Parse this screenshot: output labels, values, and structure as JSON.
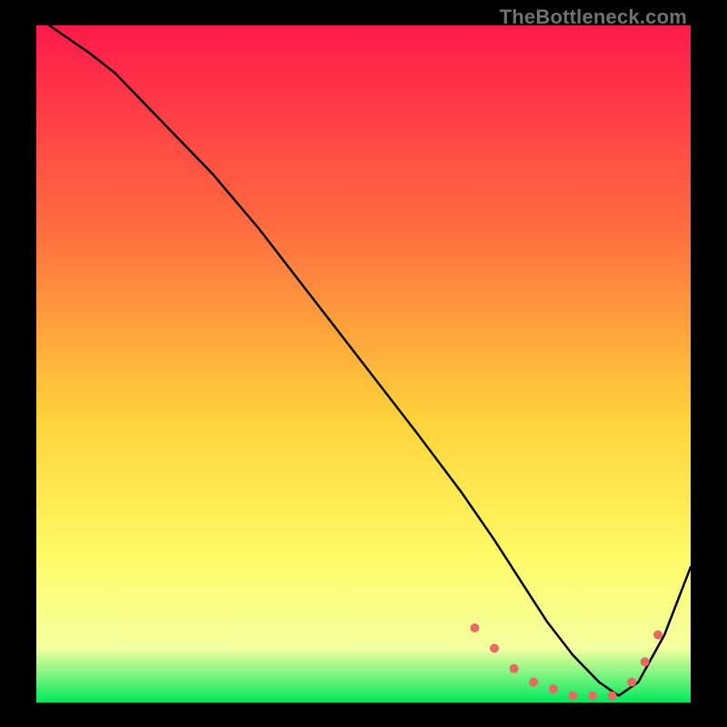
{
  "watermark": "TheBottleneck.com",
  "colors": {
    "bg": "#000000",
    "grad_top": "#ff1a4b",
    "grad_mid1": "#ff6d3f",
    "grad_mid2": "#ffd23a",
    "grad_mid3": "#fffb66",
    "grad_mid4": "#f4ffa0",
    "grad_bot": "#00e85c",
    "curve": "#000000",
    "marker": "#e86a63"
  },
  "chart_data": {
    "type": "line",
    "title": "",
    "xlabel": "",
    "ylabel": "",
    "xlim": [
      0,
      100
    ],
    "ylim": [
      0,
      100
    ],
    "series": [
      {
        "name": "curve",
        "x": [
          2,
          5,
          8,
          12,
          16,
          21,
          27,
          34,
          42,
          50,
          58,
          65,
          70,
          74,
          78,
          82,
          86,
          89,
          92,
          96,
          100
        ],
        "y": [
          100,
          98,
          96,
          93,
          89,
          84,
          78,
          70,
          60,
          50,
          40,
          31,
          24,
          18,
          12,
          7,
          3,
          1,
          3,
          10,
          20
        ]
      }
    ],
    "markers": [
      {
        "x": 67,
        "y": 11
      },
      {
        "x": 70,
        "y": 8
      },
      {
        "x": 73,
        "y": 5
      },
      {
        "x": 76,
        "y": 3
      },
      {
        "x": 79,
        "y": 2
      },
      {
        "x": 82,
        "y": 1
      },
      {
        "x": 85,
        "y": 1
      },
      {
        "x": 88,
        "y": 1
      },
      {
        "x": 91,
        "y": 3
      },
      {
        "x": 93,
        "y": 6
      },
      {
        "x": 95,
        "y": 10
      }
    ]
  }
}
